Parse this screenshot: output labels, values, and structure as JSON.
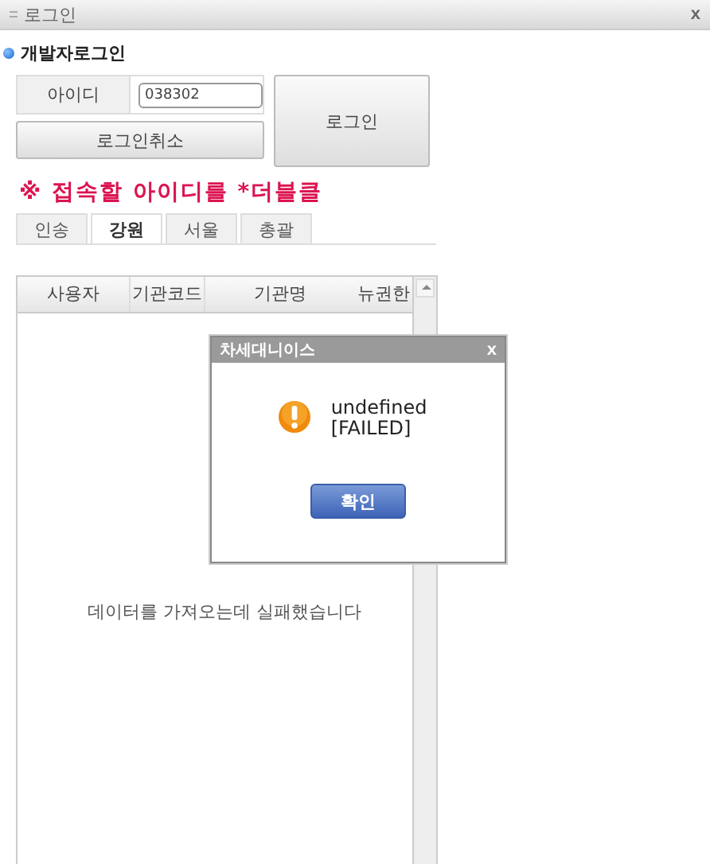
{
  "window": {
    "title": "로그인",
    "close": "x"
  },
  "heading": "개발자로그인",
  "login": {
    "id_label": "아이디",
    "id_value": "038302",
    "cancel_button": "로그인취소",
    "login_button": "로그인"
  },
  "notice": "※ 접속할 아이디를 *더블클",
  "tabs": [
    {
      "label": "인송",
      "selected": false
    },
    {
      "label": "강원",
      "selected": true
    },
    {
      "label": "서울",
      "selected": false
    },
    {
      "label": "총괄",
      "selected": false
    }
  ],
  "table": {
    "columns": [
      "사용자",
      "기관코드",
      "기관명",
      "뉴권한"
    ],
    "empty_message": "데이터를 가져오는데 실패했습니다"
  },
  "dialog": {
    "title": "차세대니이스",
    "close": "x",
    "message_lines": [
      "undefined",
      "[FAILED]"
    ],
    "button": "확인"
  }
}
